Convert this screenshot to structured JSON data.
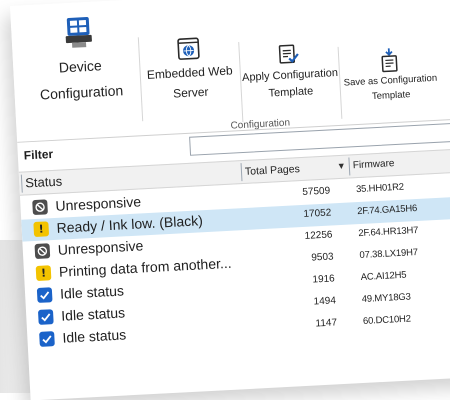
{
  "ribbon": {
    "buttons": [
      {
        "label_line1": "Device",
        "label_line2": "Configuration",
        "icon": "device-configuration-icon"
      },
      {
        "label_line1": "Embedded Web",
        "label_line2": "Server",
        "icon": "embedded-web-server-icon"
      },
      {
        "label_line1": "Apply Configuration",
        "label_line2": "Template",
        "icon": "apply-template-icon"
      },
      {
        "label_line1": "Save as Configuration",
        "label_line2": "Template",
        "icon": "save-template-icon"
      }
    ],
    "group_label": "Configuration"
  },
  "filter": {
    "label": "Filter",
    "value": ""
  },
  "table": {
    "columns": {
      "status": "Status",
      "pages": "Total Pages",
      "firmware": "Firmware"
    },
    "rows": [
      {
        "status": "Unresponsive",
        "icon": "unresponsive-icon",
        "pages": "57509",
        "firmware": "35.HH01R2"
      },
      {
        "status": "Ready / Ink low. (Black)",
        "icon": "warning-icon",
        "pages": "17052",
        "firmware": "2F.74.GA15H6"
      },
      {
        "status": "Unresponsive",
        "icon": "unresponsive-icon",
        "pages": "12256",
        "firmware": "2F.64.HR13H7"
      },
      {
        "status": "Printing data from another...",
        "icon": "warning-icon",
        "pages": "9503",
        "firmware": "07.38.LX19H7"
      },
      {
        "status": "Idle status",
        "icon": "idle-check-icon",
        "pages": "1916",
        "firmware": "AC.AI12H5"
      },
      {
        "status": "Idle status",
        "icon": "idle-check-icon",
        "pages": "1494",
        "firmware": "49.MY18G3"
      },
      {
        "status": "Idle status",
        "icon": "idle-check-icon",
        "pages": "1147",
        "firmware": "60.DC10H2"
      }
    ]
  },
  "colors": {
    "selected_row": "#cfe6f6",
    "accent_blue": "#1b63c9",
    "warning_yellow": "#f3c300"
  }
}
